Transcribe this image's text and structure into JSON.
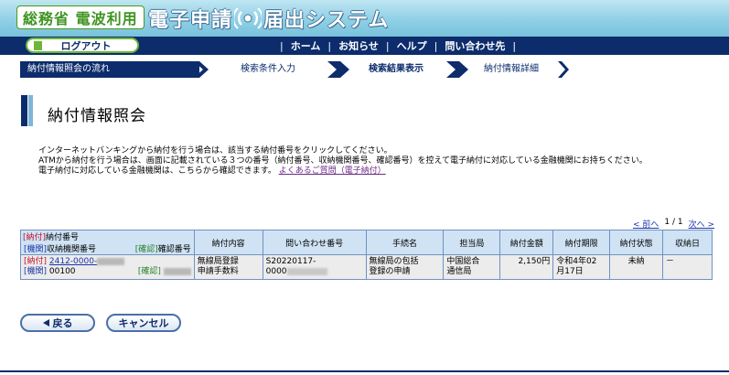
{
  "header": {
    "ministry_logo": "総務省 電波利用",
    "brand_part1": "電子申請",
    "brand_part2": "届出システム",
    "logo_color": "#3e9421",
    "header_color": "#8fd0e6"
  },
  "nav": {
    "logout_label": "ログアウト",
    "links": [
      "ホーム",
      "お知らせ",
      "ヘルプ",
      "問い合わせ先"
    ],
    "color": "#0c2c6c"
  },
  "flow": {
    "label": "納付情報照会の流れ",
    "steps": [
      "検索条件入力",
      "検索結果表示",
      "納付情報詳細"
    ],
    "current_step": "検索結果表示"
  },
  "page": {
    "title": "納付情報照会",
    "desc_line1": "インターネットバンキングから納付を行う場合は、該当する納付番号をクリックしてください。",
    "desc_line2": "ATMから納付を行う場合は、画面に記載されている３つの番号（納付番号、収納機関番号、確認番号）を控えて電子納付に対応している金融機関にお持ちください。",
    "desc_line3": "電子納付に対応している金融機関は、こちらから確認できます。",
    "faq_link": "よくあるご質問（電子納付）"
  },
  "pager": {
    "prev": "< 前へ",
    "status": "1 / 1",
    "next": "次へ >"
  },
  "table": {
    "headers": {
      "tag_payment": "[納付]",
      "payment_number": "納付番号",
      "tag_agency": "[機関]",
      "agency_number": "収納機関番号",
      "tag_confirm": "[確認]",
      "confirm_number": "確認番号",
      "content": "納付内容",
      "inquiry_number": "問い合わせ番号",
      "procedure": "手続名",
      "office": "担当局",
      "amount": "納付金額",
      "deadline": "納付期限",
      "status": "納付状態",
      "paid_date": "収納日"
    },
    "rows": [
      {
        "tag_payment": "[納付]",
        "payment_number": "2412-0000-",
        "tag_agency": "[機関]",
        "agency_number": "00100",
        "tag_confirm": "[確認]",
        "content_line1": "無線局登録",
        "content_line2": "申請手数料",
        "inquiry_line1": "S20220117-",
        "inquiry_line2": "0000",
        "procedure_line1": "無線局の包括",
        "procedure_line2": "登録の申請",
        "office_line1": "中国総合",
        "office_line2": "通信局",
        "amount": "2,150円",
        "deadline_line1": "令和4年02",
        "deadline_line2": "月17日",
        "status": "未納",
        "paid_date": "－"
      }
    ]
  },
  "buttons": {
    "back": "戻る",
    "cancel": "キャンセル"
  }
}
